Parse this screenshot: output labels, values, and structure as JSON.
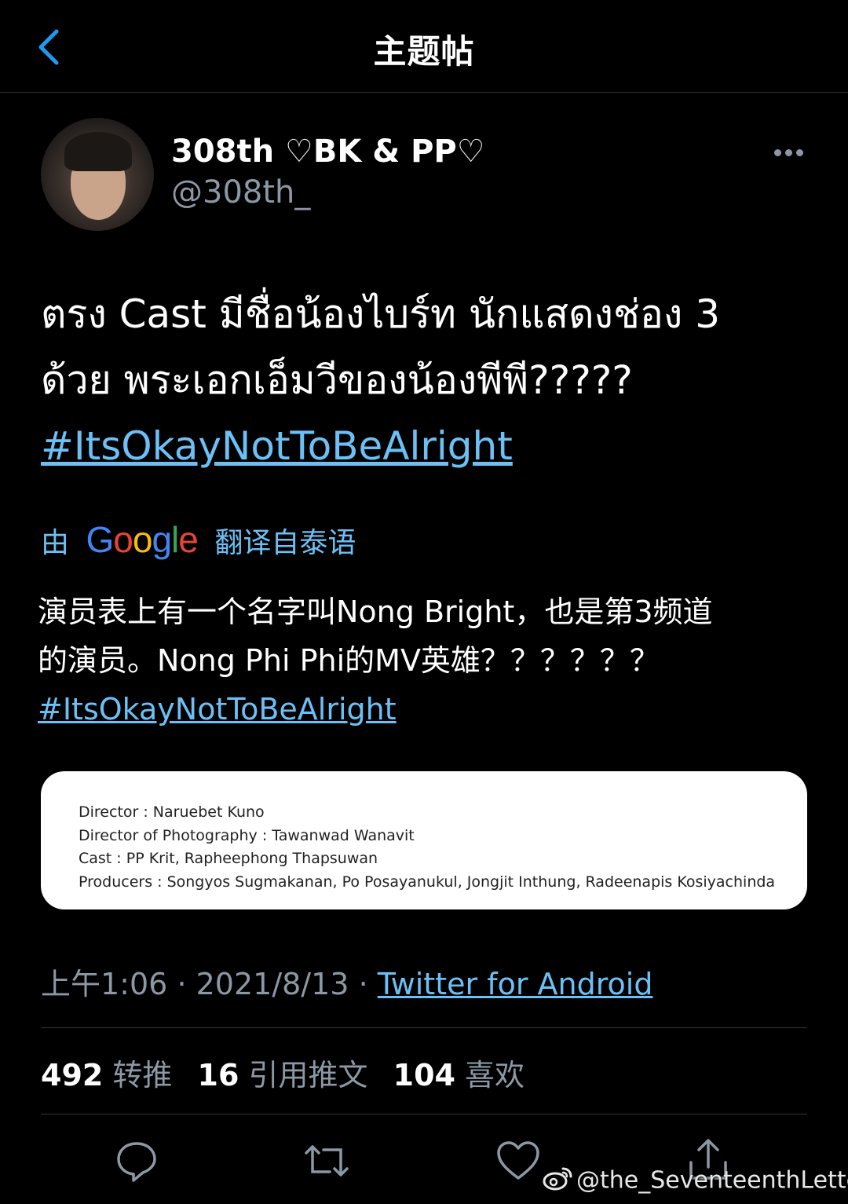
{
  "header": {
    "title": "主题帖"
  },
  "author": {
    "display_name": "308th ♡BK & PP♡",
    "handle": "@308th_"
  },
  "tweet": {
    "lines": [
      "ตรง Cast มีชื่อน้องไบร์ท นักแสดงช่อง 3",
      "ด้วย พระเอกเอ็มวีของน้องพีพี?????"
    ],
    "hashtag": "#ItsOkayNotToBeAlright"
  },
  "translation": {
    "prefix": "由",
    "provider": "Google",
    "suffix": "翻译自泰语",
    "lines": [
      "演员表上有一个名字叫Nong Bright，也是第3频道",
      "的演员。Nong Phi Phi的MV英雄？？？？？？"
    ],
    "hashtag": "#ItsOkayNotToBeAlright"
  },
  "media_card": {
    "credits": [
      "Director : Naruebet Kuno",
      "Director of Photography : Tawanwad Wanavit",
      "Cast : PP Krit, Rapheephong Thapsuwan",
      "Producers : Songyos Sugmakanan, Po Posayanukul, Jongjit Inthung, Radeenapis Kosiyachinda"
    ]
  },
  "meta": {
    "time": "上午1:06",
    "separator": "·",
    "date": "2021/8/13",
    "source": "Twitter for Android"
  },
  "stats": {
    "retweets": {
      "count": "492",
      "label": "转推"
    },
    "quotes": {
      "count": "16",
      "label": "引用推文"
    },
    "likes": {
      "count": "104",
      "label": "喜欢"
    }
  },
  "actions": [
    "reply-icon",
    "retweet-icon",
    "like-icon",
    "share-icon"
  ],
  "watermark": {
    "text": "@the_SeventeenthLetter"
  },
  "colors": {
    "background": "#000000",
    "link": "#6cc0f5",
    "secondary_text": "#8b98a5",
    "divider": "#2f3336"
  }
}
